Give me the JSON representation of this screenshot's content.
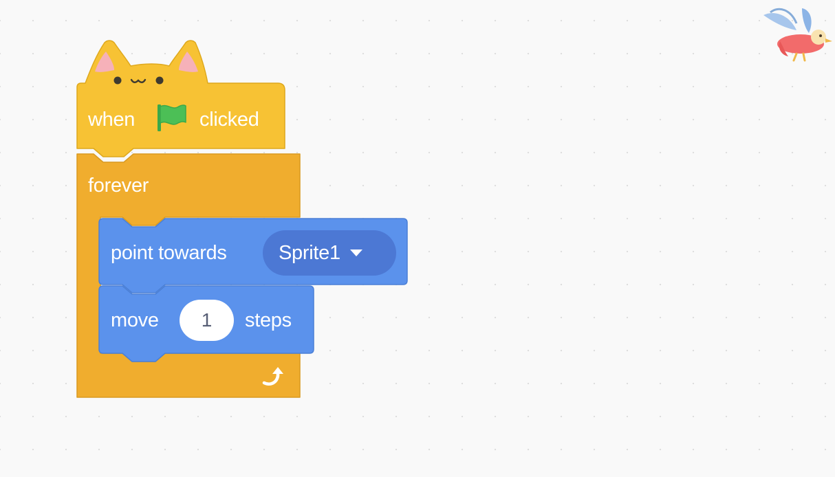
{
  "workspace": {
    "background_color": "#f9f9f9"
  },
  "hat_block": {
    "label_when": "when",
    "label_clicked": "clicked",
    "flag_icon": "green-flag-icon",
    "style": "cat-ears",
    "color": "#ffbf00"
  },
  "forever_block": {
    "label": "forever",
    "loop_icon": "loop-arrow-icon",
    "color": "#ffab19"
  },
  "point_towards_block": {
    "label": "point towards",
    "target_value": "Sprite1",
    "color": "#4c97ff",
    "field_color": "#4c78d4"
  },
  "move_block": {
    "label_move": "move",
    "steps_value": "1",
    "label_steps": "steps",
    "color": "#4c97ff"
  },
  "corner_logo": {
    "icon": "bird-logo-icon"
  }
}
